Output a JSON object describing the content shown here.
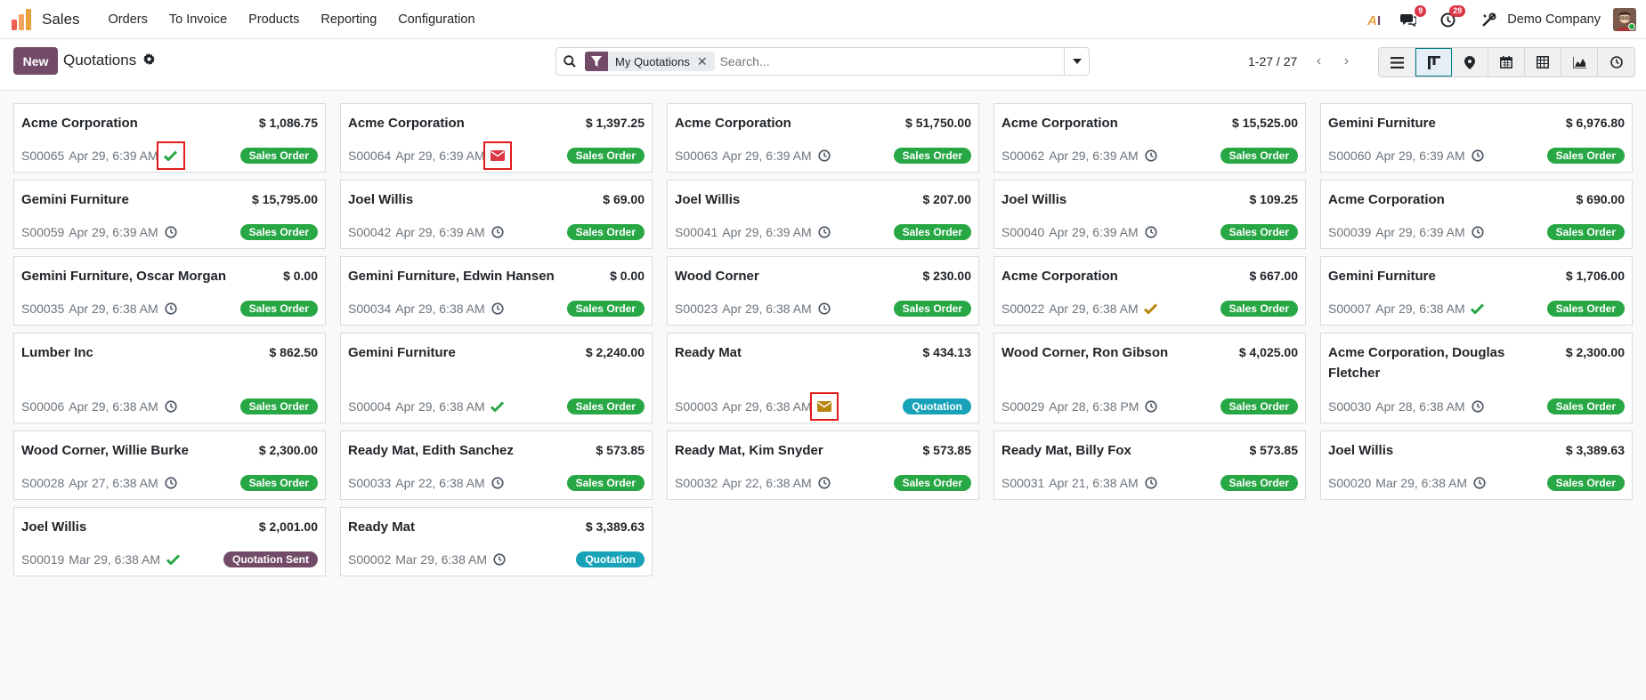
{
  "navbar": {
    "app_name": "Sales",
    "menu": [
      "Orders",
      "To Invoice",
      "Products",
      "Reporting",
      "Configuration"
    ],
    "messages_count": "9",
    "activities_count": "29",
    "company": "Demo Company"
  },
  "control": {
    "new_label": "New",
    "title": "Quotations",
    "facet_label": "My Quotations",
    "search_placeholder": "Search...",
    "pager": "1-27 / 27"
  },
  "colors": {
    "brand": "#714b67",
    "sales_order": "#28a745",
    "quotation": "#17a2b8",
    "quotation_sent": "#714b67",
    "highlight": "#e11b1b",
    "activity_done": "#28a745",
    "activity_mail_red": "#dc3545",
    "activity_mail_warn": "#b8860b"
  },
  "cards": [
    {
      "name": "Acme Corporation",
      "amount": "$ 1,086.75",
      "ref": "S00065",
      "date": "Apr 29, 6:39 AM",
      "icon": "check-icon",
      "state": "Sales Order",
      "highlight": true
    },
    {
      "name": "Acme Corporation",
      "amount": "$ 1,397.25",
      "ref": "S00064",
      "date": "Apr 29, 6:39 AM",
      "icon": "envelope-red-icon",
      "state": "Sales Order",
      "highlight": true
    },
    {
      "name": "Acme Corporation",
      "amount": "$ 51,750.00",
      "ref": "S00063",
      "date": "Apr 29, 6:39 AM",
      "icon": "clock-icon",
      "state": "Sales Order"
    },
    {
      "name": "Acme Corporation",
      "amount": "$ 15,525.00",
      "ref": "S00062",
      "date": "Apr 29, 6:39 AM",
      "icon": "clock-icon",
      "state": "Sales Order"
    },
    {
      "name": "Gemini Furniture",
      "amount": "$ 6,976.80",
      "ref": "S00060",
      "date": "Apr 29, 6:39 AM",
      "icon": "clock-icon",
      "state": "Sales Order"
    },
    {
      "name": "Gemini Furniture",
      "amount": "$ 15,795.00",
      "ref": "S00059",
      "date": "Apr 29, 6:39 AM",
      "icon": "clock-icon",
      "state": "Sales Order"
    },
    {
      "name": "Joel Willis",
      "amount": "$ 69.00",
      "ref": "S00042",
      "date": "Apr 29, 6:39 AM",
      "icon": "clock-icon",
      "state": "Sales Order"
    },
    {
      "name": "Joel Willis",
      "amount": "$ 207.00",
      "ref": "S00041",
      "date": "Apr 29, 6:39 AM",
      "icon": "clock-icon",
      "state": "Sales Order"
    },
    {
      "name": "Joel Willis",
      "amount": "$ 109.25",
      "ref": "S00040",
      "date": "Apr 29, 6:39 AM",
      "icon": "clock-icon",
      "state": "Sales Order"
    },
    {
      "name": "Acme Corporation",
      "amount": "$ 690.00",
      "ref": "S00039",
      "date": "Apr 29, 6:39 AM",
      "icon": "clock-icon",
      "state": "Sales Order"
    },
    {
      "name": "Gemini Furniture, Oscar Morgan",
      "amount": "$ 0.00",
      "ref": "S00035",
      "date": "Apr 29, 6:38 AM",
      "icon": "clock-icon",
      "state": "Sales Order"
    },
    {
      "name": "Gemini Furniture, Edwin Hansen",
      "amount": "$ 0.00",
      "ref": "S00034",
      "date": "Apr 29, 6:38 AM",
      "icon": "clock-icon",
      "state": "Sales Order"
    },
    {
      "name": "Wood Corner",
      "amount": "$ 230.00",
      "ref": "S00023",
      "date": "Apr 29, 6:38 AM",
      "icon": "clock-icon",
      "state": "Sales Order"
    },
    {
      "name": "Acme Corporation",
      "amount": "$ 667.00",
      "ref": "S00022",
      "date": "Apr 29, 6:38 AM",
      "icon": "check-warn-icon",
      "state": "Sales Order"
    },
    {
      "name": "Gemini Furniture",
      "amount": "$ 1,706.00",
      "ref": "S00007",
      "date": "Apr 29, 6:38 AM",
      "icon": "check-icon",
      "state": "Sales Order"
    },
    {
      "name": "Lumber Inc",
      "amount": "$ 862.50",
      "ref": "S00006",
      "date": "Apr 29, 6:38 AM",
      "icon": "clock-icon",
      "state": "Sales Order"
    },
    {
      "name": "Gemini Furniture",
      "amount": "$ 2,240.00",
      "ref": "S00004",
      "date": "Apr 29, 6:38 AM",
      "icon": "check-icon",
      "state": "Sales Order"
    },
    {
      "name": "Ready Mat",
      "amount": "$ 434.13",
      "ref": "S00003",
      "date": "Apr 29, 6:38 AM",
      "icon": "envelope-warn-icon",
      "state": "Quotation",
      "highlight": true
    },
    {
      "name": "Wood Corner, Ron Gibson",
      "amount": "$ 4,025.00",
      "ref": "S00029",
      "date": "Apr 28, 6:38 PM",
      "icon": "clock-icon",
      "state": "Sales Order"
    },
    {
      "name": "Acme Corporation, Douglas Fletcher",
      "amount": "$ 2,300.00",
      "ref": "S00030",
      "date": "Apr 28, 6:38 AM",
      "icon": "clock-icon",
      "state": "Sales Order"
    },
    {
      "name": "Wood Corner, Willie Burke",
      "amount": "$ 2,300.00",
      "ref": "S00028",
      "date": "Apr 27, 6:38 AM",
      "icon": "clock-icon",
      "state": "Sales Order"
    },
    {
      "name": "Ready Mat, Edith Sanchez",
      "amount": "$ 573.85",
      "ref": "S00033",
      "date": "Apr 22, 6:38 AM",
      "icon": "clock-icon",
      "state": "Sales Order"
    },
    {
      "name": "Ready Mat, Kim Snyder",
      "amount": "$ 573.85",
      "ref": "S00032",
      "date": "Apr 22, 6:38 AM",
      "icon": "clock-icon",
      "state": "Sales Order"
    },
    {
      "name": "Ready Mat, Billy Fox",
      "amount": "$ 573.85",
      "ref": "S00031",
      "date": "Apr 21, 6:38 AM",
      "icon": "clock-icon",
      "state": "Sales Order"
    },
    {
      "name": "Joel Willis",
      "amount": "$ 3,389.63",
      "ref": "S00020",
      "date": "Mar 29, 6:38 AM",
      "icon": "clock-icon",
      "state": "Sales Order"
    },
    {
      "name": "Joel Willis",
      "amount": "$ 2,001.00",
      "ref": "S00019",
      "date": "Mar 29, 6:38 AM",
      "icon": "check-icon",
      "state": "Quotation Sent"
    },
    {
      "name": "Ready Mat",
      "amount": "$ 3,389.63",
      "ref": "S00002",
      "date": "Mar 29, 6:38 AM",
      "icon": "clock-icon",
      "state": "Quotation"
    }
  ]
}
